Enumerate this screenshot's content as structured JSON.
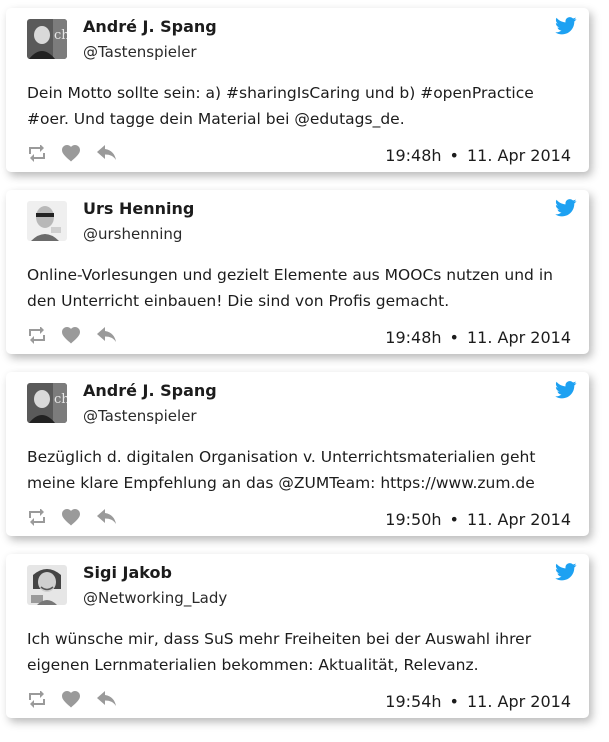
{
  "tweets": [
    {
      "name": "André J. Spang",
      "handle": "@Tastenspieler",
      "text": "Dein Motto sollte sein: a) #sharingIsCaring und b) #openPractice #oer. Und tagge dein Material bei @edutags_de.",
      "time": "19:48h",
      "date": "11. Apr 2014",
      "avatar": "portrait-dark-with-ch-logo"
    },
    {
      "name": "Urs Henning",
      "handle": "@urshenning",
      "text": "Online-Vorlesungen und gezielt Elemente aus MOOCs nutzen und in den Unterricht einbauen! Die sind von Profis gemacht.",
      "time": "19:48h",
      "date": "11. Apr 2014",
      "avatar": "portrait-man-glasses"
    },
    {
      "name": "André J. Spang",
      "handle": "@Tastenspieler",
      "text": "Bezüglich d. digitalen Organisation v. Unterrichtsmaterialien geht meine klare Empfehlung an das @ZUMTeam: https://www.zum.de",
      "time": "19:50h",
      "date": "11. Apr 2014",
      "avatar": "portrait-dark-with-ch-logo"
    },
    {
      "name": "Sigi Jakob",
      "handle": "@Networking_Lady",
      "text": "Ich wünsche mir, dass SuS mehr Freiheiten bei der Auswahl ihrer eigenen Lernmaterialien bekommen: Aktualität, Relevanz.",
      "time": "19:54h",
      "date": "11. Apr 2014",
      "avatar": "portrait-woman-smiling"
    }
  ],
  "separator": "•",
  "icons": {
    "brand": "twitter-bird-icon",
    "retweet": "retweet-icon",
    "like": "heart-icon",
    "reply": "reply-icon"
  },
  "colors": {
    "twitter_blue": "#1da1f2",
    "action_gray": "#9a9a9a",
    "text": "#1c1c1c"
  }
}
